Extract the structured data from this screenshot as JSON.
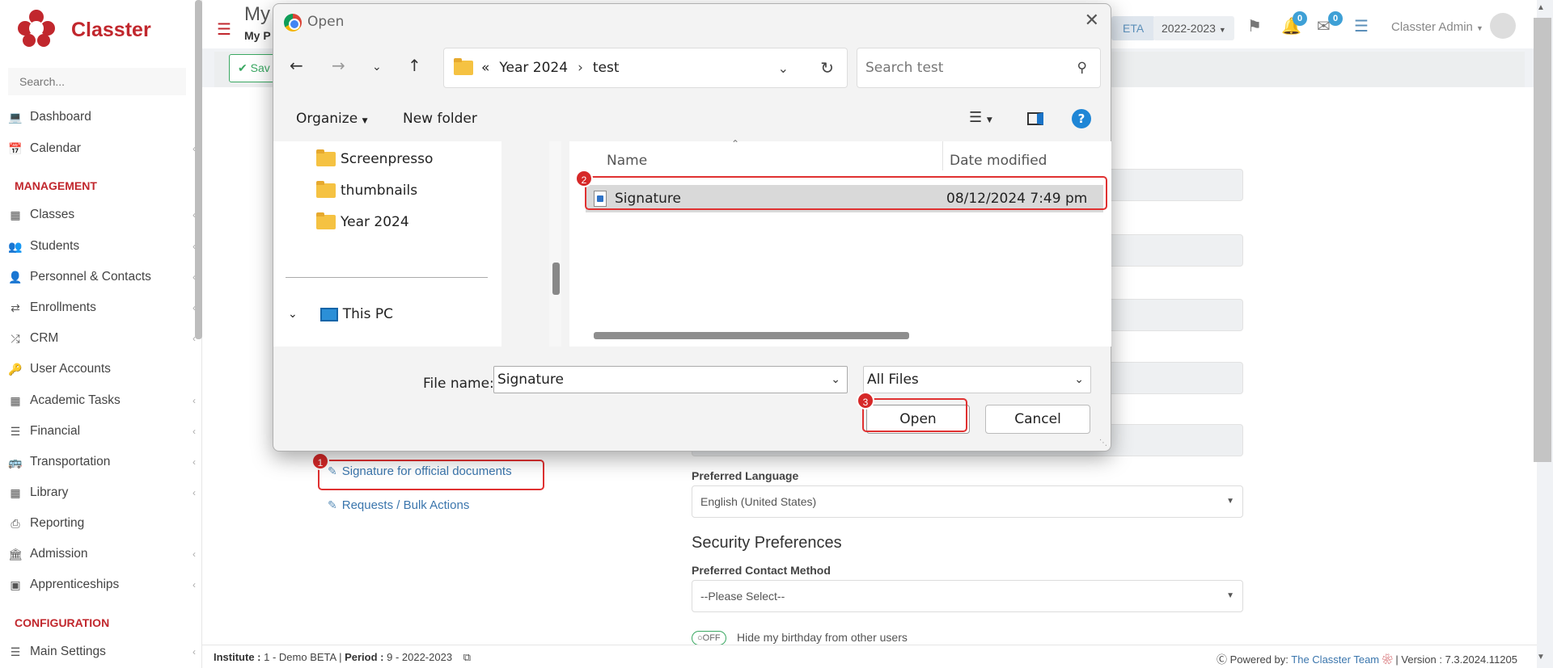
{
  "app": {
    "brand": "Classter",
    "page_title": "My",
    "page_subtitle": "My P",
    "save_label": "Sav"
  },
  "sidebar": {
    "search_placeholder": "Search...",
    "items_top": [
      {
        "label": "Dashboard",
        "icon": "laptop-icon"
      },
      {
        "label": "Calendar",
        "icon": "calendar-icon"
      }
    ],
    "section_management": "MANAGEMENT",
    "items_management": [
      {
        "label": "Classes",
        "icon": "classes-icon"
      },
      {
        "label": "Students",
        "icon": "students-icon"
      },
      {
        "label": "Personnel & Contacts",
        "icon": "personnel-icon"
      },
      {
        "label": "Enrollments",
        "icon": "enrollments-icon"
      },
      {
        "label": "CRM",
        "icon": "crm-icon"
      },
      {
        "label": "User Accounts",
        "icon": "key-icon"
      },
      {
        "label": "Academic Tasks",
        "icon": "grid-icon"
      },
      {
        "label": "Financial",
        "icon": "coins-icon"
      },
      {
        "label": "Transportation",
        "icon": "bus-icon"
      },
      {
        "label": "Library",
        "icon": "books-icon"
      },
      {
        "label": "Reporting",
        "icon": "printer-icon"
      },
      {
        "label": "Admission",
        "icon": "institution-icon"
      },
      {
        "label": "Apprenticeships",
        "icon": "box-icon"
      }
    ],
    "section_configuration": "CONFIGURATION",
    "items_configuration": [
      {
        "label": "Main Settings",
        "icon": "sliders-icon"
      }
    ]
  },
  "topbar": {
    "beta_label": "ETA",
    "period": "2022-2023",
    "notifications_count": "0",
    "messages_count": "0",
    "user_name": "Classter Admin"
  },
  "profile_links": {
    "signature": "Signature for official documents",
    "requests": "Requests / Bulk Actions"
  },
  "form": {
    "preferred_language_label": "Preferred Language",
    "preferred_language_value": "English (United States)",
    "security_title": "Security Preferences",
    "contact_method_label": "Preferred Contact Method",
    "contact_method_value": "--Please Select--",
    "birthday_toggle": "OFF",
    "birthday_label": "Hide my birthday from other users"
  },
  "footer": {
    "institute_label": "Institute :",
    "institute_value": "1 - Demo BETA",
    "period_label": "Period :",
    "period_value": "9 - 2022-2023",
    "powered_by": "Powered by:",
    "team": "The Classter Team",
    "version": "| Version : 7.3.2024.11205"
  },
  "dialog": {
    "title": "Open",
    "breadcrumb": [
      "Year 2024",
      "test"
    ],
    "breadcrumb_prefix": "«",
    "search_placeholder": "Search test",
    "organize_label": "Organize",
    "new_folder_label": "New folder",
    "nav_folders": [
      "Screenpresso",
      "thumbnails",
      "Year 2024"
    ],
    "this_pc": "This PC",
    "columns": {
      "name": "Name",
      "date": "Date modified"
    },
    "files": [
      {
        "name": "Signature",
        "date": "08/12/2024 7:49 pm"
      }
    ],
    "file_name_label": "File name:",
    "file_name_value": "Signature",
    "file_type": "All Files",
    "open_label": "Open",
    "cancel_label": "Cancel"
  },
  "annotations": [
    "1",
    "2",
    "3"
  ],
  "colors": {
    "brand": "#c1272d",
    "link": "#3b76ad",
    "annotation": "#e03131"
  }
}
